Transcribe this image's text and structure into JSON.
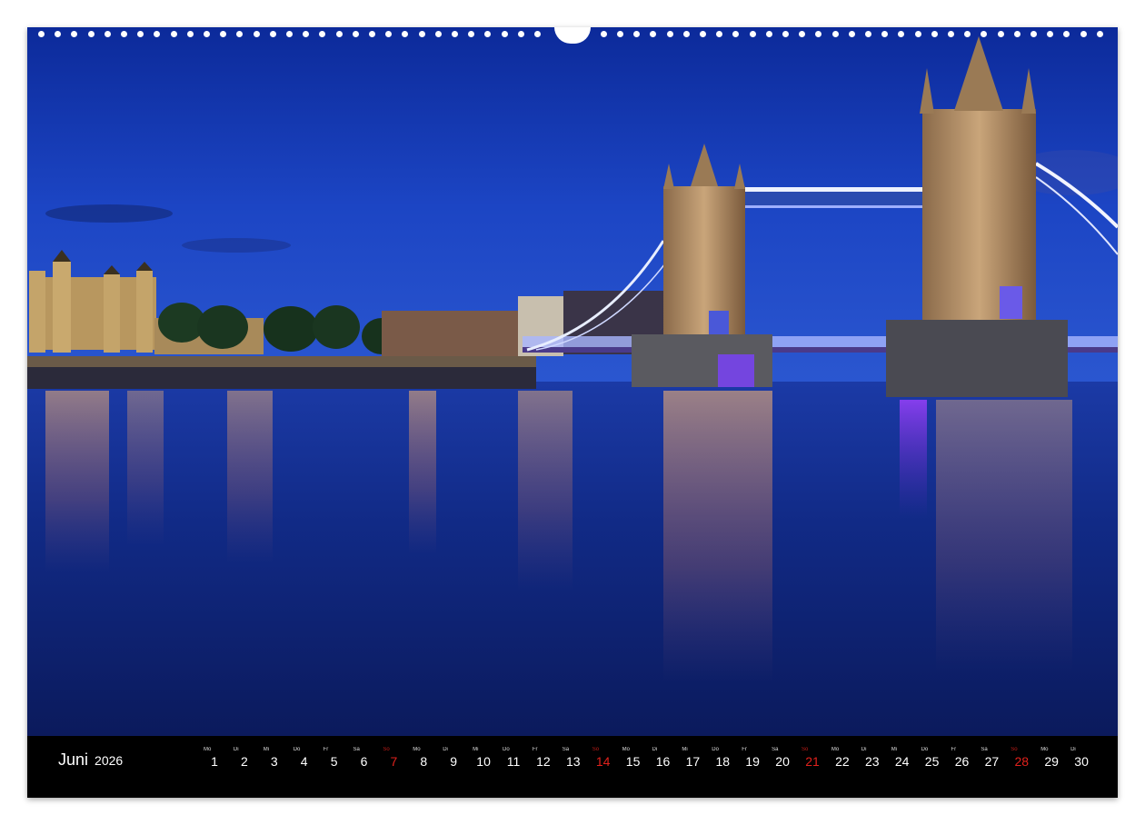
{
  "calendar": {
    "month": "Juni",
    "year": "2026",
    "sunday_color": "#e0211c",
    "days": [
      {
        "dow": "Mo",
        "num": "1",
        "sunday": false
      },
      {
        "dow": "Di",
        "num": "2",
        "sunday": false
      },
      {
        "dow": "Mi",
        "num": "3",
        "sunday": false
      },
      {
        "dow": "Do",
        "num": "4",
        "sunday": false
      },
      {
        "dow": "Fr",
        "num": "5",
        "sunday": false
      },
      {
        "dow": "Sa",
        "num": "6",
        "sunday": false
      },
      {
        "dow": "So",
        "num": "7",
        "sunday": true
      },
      {
        "dow": "Mo",
        "num": "8",
        "sunday": false
      },
      {
        "dow": "Di",
        "num": "9",
        "sunday": false
      },
      {
        "dow": "Mi",
        "num": "10",
        "sunday": false
      },
      {
        "dow": "Do",
        "num": "11",
        "sunday": false
      },
      {
        "dow": "Fr",
        "num": "12",
        "sunday": false
      },
      {
        "dow": "Sa",
        "num": "13",
        "sunday": false
      },
      {
        "dow": "So",
        "num": "14",
        "sunday": true
      },
      {
        "dow": "Mo",
        "num": "15",
        "sunday": false
      },
      {
        "dow": "Di",
        "num": "16",
        "sunday": false
      },
      {
        "dow": "Mi",
        "num": "17",
        "sunday": false
      },
      {
        "dow": "Do",
        "num": "18",
        "sunday": false
      },
      {
        "dow": "Fr",
        "num": "19",
        "sunday": false
      },
      {
        "dow": "Sa",
        "num": "20",
        "sunday": false
      },
      {
        "dow": "So",
        "num": "21",
        "sunday": true
      },
      {
        "dow": "Mo",
        "num": "22",
        "sunday": false
      },
      {
        "dow": "Di",
        "num": "23",
        "sunday": false
      },
      {
        "dow": "Mi",
        "num": "24",
        "sunday": false
      },
      {
        "dow": "Do",
        "num": "25",
        "sunday": false
      },
      {
        "dow": "Fr",
        "num": "26",
        "sunday": false
      },
      {
        "dow": "Sa",
        "num": "27",
        "sunday": false
      },
      {
        "dow": "So",
        "num": "28",
        "sunday": true
      },
      {
        "dow": "Mo",
        "num": "29",
        "sunday": false
      },
      {
        "dow": "Di",
        "num": "30",
        "sunday": false
      }
    ]
  },
  "photo": {
    "subject": "tower-bridge-night-photo",
    "sky_color": "#1a3fb8",
    "water_color": "#0e1f6e"
  }
}
